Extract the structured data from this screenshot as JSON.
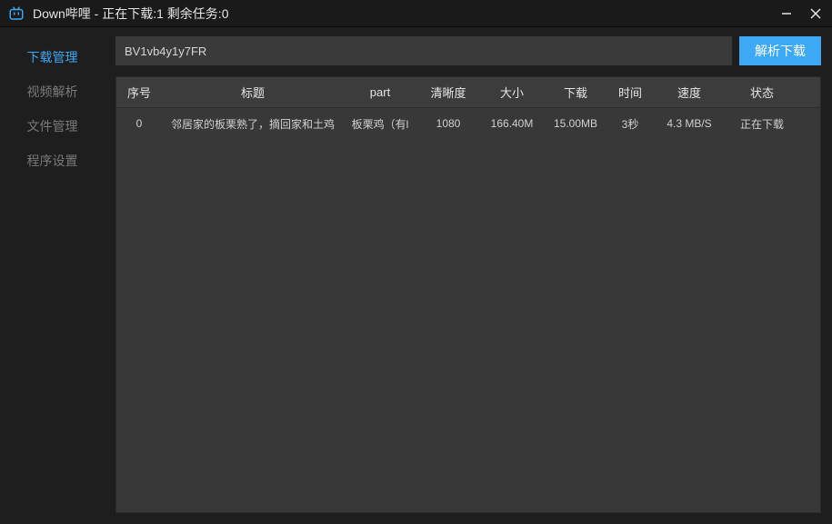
{
  "titlebar": {
    "title": "Down哔哩 - 正在下载:1  剩余任务:0"
  },
  "sidebar": {
    "items": [
      {
        "label": "下载管理"
      },
      {
        "label": "视频解析"
      },
      {
        "label": "文件管理"
      },
      {
        "label": "程序设置"
      }
    ]
  },
  "search": {
    "value": "BV1vb4y1y7FR"
  },
  "buttons": {
    "parse": "解析下载"
  },
  "table": {
    "headers": {
      "seq": "序号",
      "title": "标题",
      "part": "part",
      "quality": "清晰度",
      "size": "大小",
      "download": "下载",
      "time": "时间",
      "speed": "速度",
      "status": "状态"
    },
    "rows": [
      {
        "seq": "0",
        "title": "邻居家的板栗熟了，摘回家和土鸡",
        "part": "板栗鸡（有l",
        "quality": "1080",
        "size": "166.40M",
        "download": "15.00MB",
        "time": "3秒",
        "speed": "4.3 MB/S",
        "status": "正在下载"
      }
    ]
  }
}
